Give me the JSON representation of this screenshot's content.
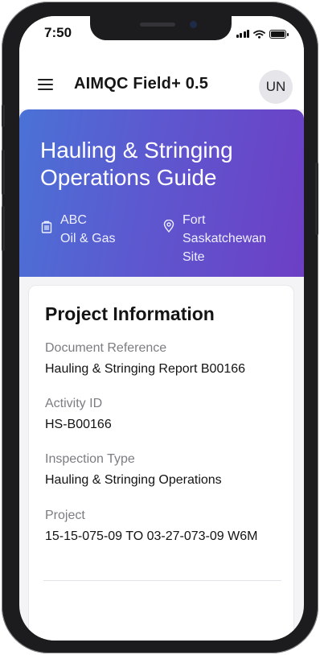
{
  "status_bar": {
    "time": "7:50",
    "icons": [
      "signal-icon",
      "wifi-icon",
      "battery-icon"
    ]
  },
  "header": {
    "menu_icon": "hamburger-menu-icon",
    "title": "AIMQC Field+ 0.5",
    "avatar_initials": "UN"
  },
  "hero": {
    "title": "Hauling & Stringing Operations Guide",
    "company_icon": "building-icon",
    "company_line1": "ABC",
    "company_line2": "Oil & Gas",
    "location_icon": "location-pin-icon",
    "location_line1": "Fort",
    "location_line2": "Saskatchewan",
    "location_line3": "Site",
    "gradient_colors": [
      "#4a72d6",
      "#6d3fc4"
    ]
  },
  "project_info": {
    "title": "Project Information",
    "fields": [
      {
        "label": "Document Reference",
        "value": "Hauling & Stringing Report B00166"
      },
      {
        "label": "Activity ID",
        "value": "HS-B00166"
      },
      {
        "label": "Inspection Type",
        "value": "Hauling & Stringing Operations"
      },
      {
        "label": "Project",
        "value": "15-15-075-09 TO 03-27-073-09 W6M"
      }
    ]
  }
}
